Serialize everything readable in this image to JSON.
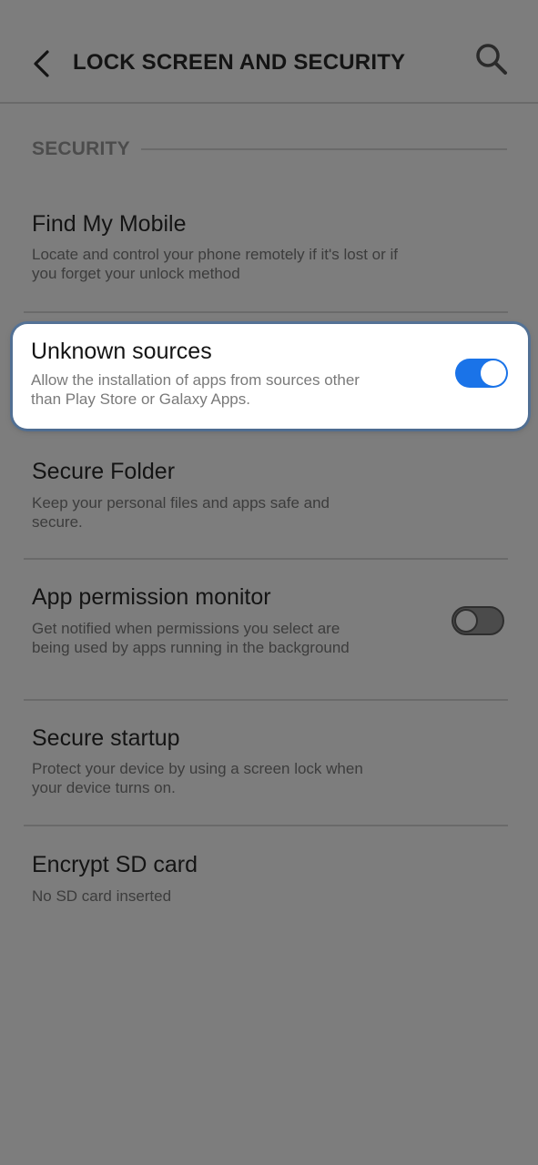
{
  "header": {
    "title": "LOCK SCREEN AND SECURITY",
    "back_icon": "chevron-left-icon",
    "search_icon": "search-icon"
  },
  "section": {
    "title": "SECURITY"
  },
  "items": [
    {
      "title": "Find My Mobile",
      "description": "Locate and control your phone remotely if it's lost or if you forget your unlock method"
    },
    {
      "title": "Unknown sources",
      "description": "Allow the installation of apps from sources other than Play Store or Galaxy Apps.",
      "toggle": "on"
    },
    {
      "title": "Secure Folder",
      "description": "Keep your personal files and apps safe and secure."
    },
    {
      "title": "App permission monitor",
      "description": "Get notified when permissions you select are being used by apps running in the background",
      "toggle": "off"
    },
    {
      "title": "Secure startup",
      "description": "Protect your device by using a screen lock when your device turns on."
    },
    {
      "title": "Encrypt SD card",
      "description": "No SD card inserted"
    }
  ],
  "colors": {
    "toggle_on": "#1a73e8",
    "overlay": "#7d7d7d"
  }
}
